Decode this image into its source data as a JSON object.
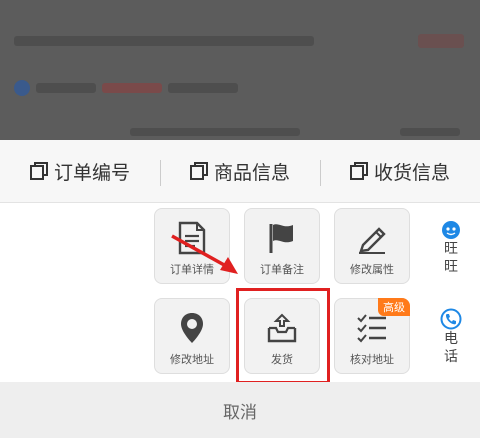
{
  "copy_bar": {
    "items": [
      {
        "label": "订单编号",
        "icon": "copy-icon"
      },
      {
        "label": "商品信息",
        "icon": "copy-icon"
      },
      {
        "label": "收货信息",
        "icon": "copy-icon"
      }
    ]
  },
  "actions": {
    "order_detail": "订单详情",
    "order_note": "订单备注",
    "edit_attributes": "修改属性",
    "edit_address": "修改地址",
    "ship": "发货",
    "verify_address": "核对地址",
    "verify_badge": "高级"
  },
  "side": {
    "wangwang": "旺旺",
    "phone": "电话"
  },
  "cancel_label": "取消",
  "colors": {
    "highlight": "#e02020",
    "badge": "#ff7a1a",
    "side_icon": "#1e88e5",
    "arrow": "#e02020"
  }
}
